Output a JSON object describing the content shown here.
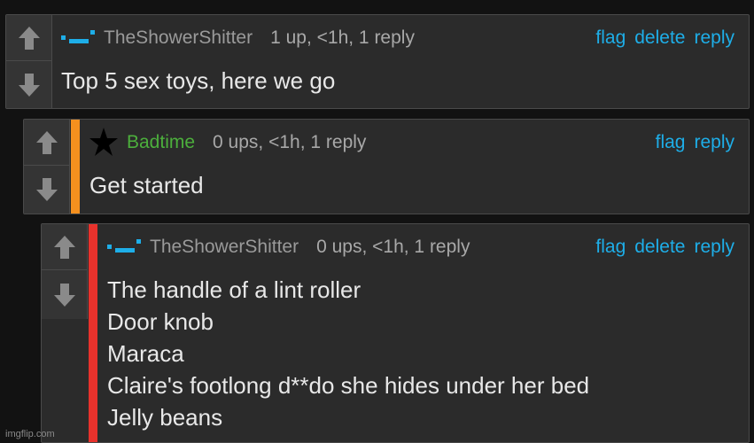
{
  "comments": [
    {
      "username": "TheShowerShitter",
      "username_color": "#9a9a9a",
      "stats": "1 up, <1h, 1 reply",
      "actions": [
        "flag",
        "delete",
        "reply"
      ],
      "body": [
        "Top 5 sex toys, here we go"
      ],
      "icon": "dash-user-icon"
    },
    {
      "username": "Badtime",
      "username_color": "#4caf3c",
      "stats": "0 ups, <1h, 1 reply",
      "actions": [
        "flag",
        "reply"
      ],
      "body": [
        "Get started"
      ],
      "accent_color": "#f5901e",
      "icon": "star-icon"
    },
    {
      "username": "TheShowerShitter",
      "username_color": "#9a9a9a",
      "stats": "0 ups, <1h, 1 reply",
      "actions": [
        "flag",
        "delete",
        "reply"
      ],
      "body": [
        "The handle of a lint roller",
        "Door knob",
        "Maraca",
        "Claire's footlong d**do she hides under her bed",
        "Jelly beans"
      ],
      "accent_color": "#e8322c",
      "icon": "dash-user-icon"
    }
  ],
  "watermark": "imgflip.com",
  "colors": {
    "link": "#1eaee8",
    "background": "#121212",
    "card": "#2b2b2b"
  }
}
